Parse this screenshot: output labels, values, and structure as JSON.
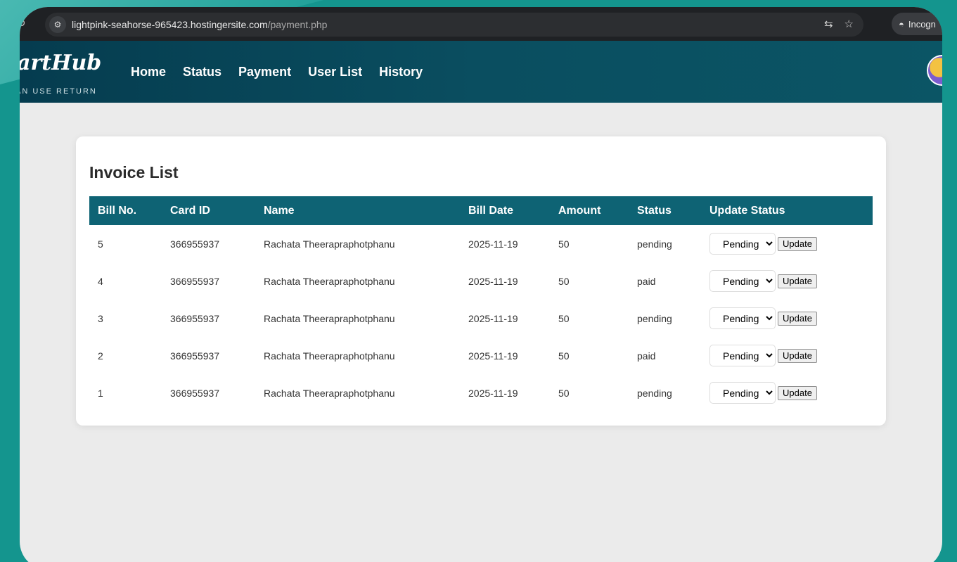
{
  "browser": {
    "url_host": "lightpink-seahorse-965423.hostingersite.com",
    "url_path": "/payment.php",
    "incognito_label": "Incogn"
  },
  "brand": {
    "logo": "artHub",
    "tagline": "AN USE RETURN"
  },
  "nav": {
    "items": [
      {
        "label": "Home"
      },
      {
        "label": "Status"
      },
      {
        "label": "Payment"
      },
      {
        "label": "User List"
      },
      {
        "label": "History"
      }
    ]
  },
  "invoice": {
    "title": "Invoice List",
    "columns": [
      "Bill No.",
      "Card ID",
      "Name",
      "Bill Date",
      "Amount",
      "Status",
      "Update Status"
    ],
    "select_value": "Pending",
    "update_label": "Update",
    "rows": [
      {
        "bill_no": "5",
        "card_id": "366955937",
        "name": "Rachata Theerapraphotphanu",
        "bill_date": "2025-11-19",
        "amount": "50",
        "status": "pending"
      },
      {
        "bill_no": "4",
        "card_id": "366955937",
        "name": "Rachata Theerapraphotphanu",
        "bill_date": "2025-11-19",
        "amount": "50",
        "status": "paid"
      },
      {
        "bill_no": "3",
        "card_id": "366955937",
        "name": "Rachata Theerapraphotphanu",
        "bill_date": "2025-11-19",
        "amount": "50",
        "status": "pending"
      },
      {
        "bill_no": "2",
        "card_id": "366955937",
        "name": "Rachata Theerapraphotphanu",
        "bill_date": "2025-11-19",
        "amount": "50",
        "status": "paid"
      },
      {
        "bill_no": "1",
        "card_id": "366955937",
        "name": "Rachata Theerapraphotphanu",
        "bill_date": "2025-11-19",
        "amount": "50",
        "status": "pending"
      }
    ]
  }
}
